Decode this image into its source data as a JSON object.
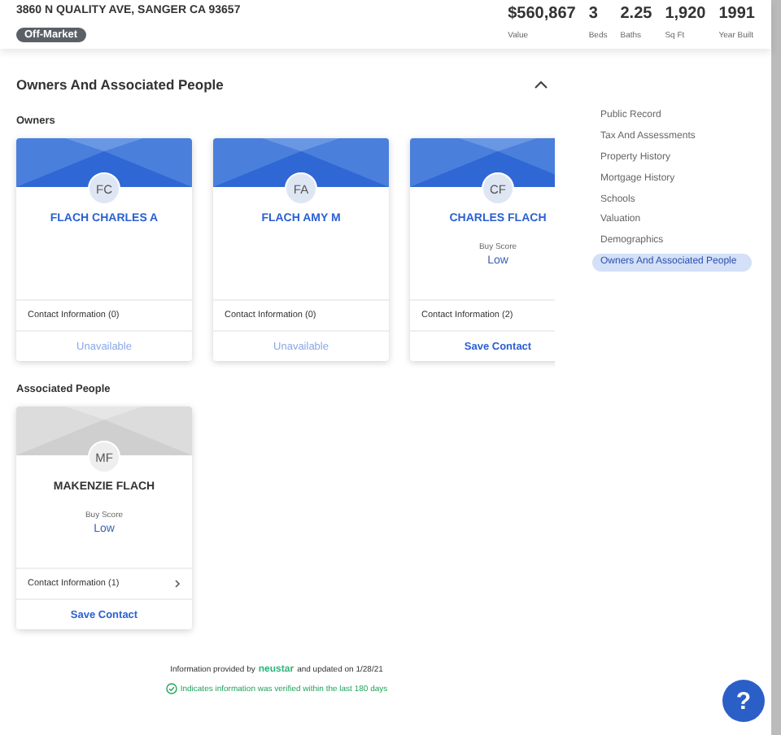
{
  "header": {
    "address": "3860 N QUALITY AVE, SANGER CA 93657",
    "status_badge": "Off-Market",
    "stats": [
      {
        "value": "$560,867",
        "label": "Value"
      },
      {
        "value": "3",
        "label": "Beds"
      },
      {
        "value": "2.25",
        "label": "Baths"
      },
      {
        "value": "1,920",
        "label": "Sq Ft"
      },
      {
        "value": "1991",
        "label": "Year Built"
      }
    ]
  },
  "section": {
    "title": "Owners And Associated People",
    "expanded": true
  },
  "groups": [
    {
      "title": "Owners",
      "cards": [
        {
          "kind": "owner",
          "initials": "FC",
          "name": "FLACH CHARLES A",
          "contact": "Contact Information (0)",
          "chevron": false,
          "action": "Unavailable",
          "disabled": true
        },
        {
          "kind": "owner",
          "initials": "FA",
          "name": "FLACH AMY M",
          "contact": "Contact Information (0)",
          "chevron": false,
          "action": "Unavailable",
          "disabled": true
        },
        {
          "kind": "owner",
          "initials": "CF",
          "name": "CHARLES FLACH",
          "score_label": "Buy Score",
          "score": "Low",
          "contact": "Contact Information (2)",
          "action": "Save Contact",
          "disabled": false
        }
      ]
    },
    {
      "title": "Associated People",
      "cards": [
        {
          "kind": "associated",
          "initials": "MF",
          "name": "MAKENZIE FLACH",
          "score_label": "Buy Score",
          "score": "Low",
          "contact": "Contact Information (1)",
          "chevron": true,
          "action": "Save Contact",
          "disabled": false
        }
      ]
    }
  ],
  "sidebar": {
    "items": [
      {
        "label": "Public Record",
        "selected": false
      },
      {
        "label": "Tax And Assessments",
        "selected": false
      },
      {
        "label": "Property History",
        "selected": false
      },
      {
        "label": "Mortgage History",
        "selected": false
      },
      {
        "label": "Schools",
        "selected": false
      },
      {
        "label": "Valuation",
        "selected": false
      },
      {
        "label": "Demographics",
        "selected": false
      },
      {
        "label": "Owners And Associated People",
        "selected": true
      }
    ]
  },
  "footer": {
    "provided_by": "Information provided by",
    "provider": "neustar",
    "updated": "and updated on 1/28/21",
    "verified_note": "Indicates information was verified within the last 180 days"
  },
  "help_button": "?"
}
